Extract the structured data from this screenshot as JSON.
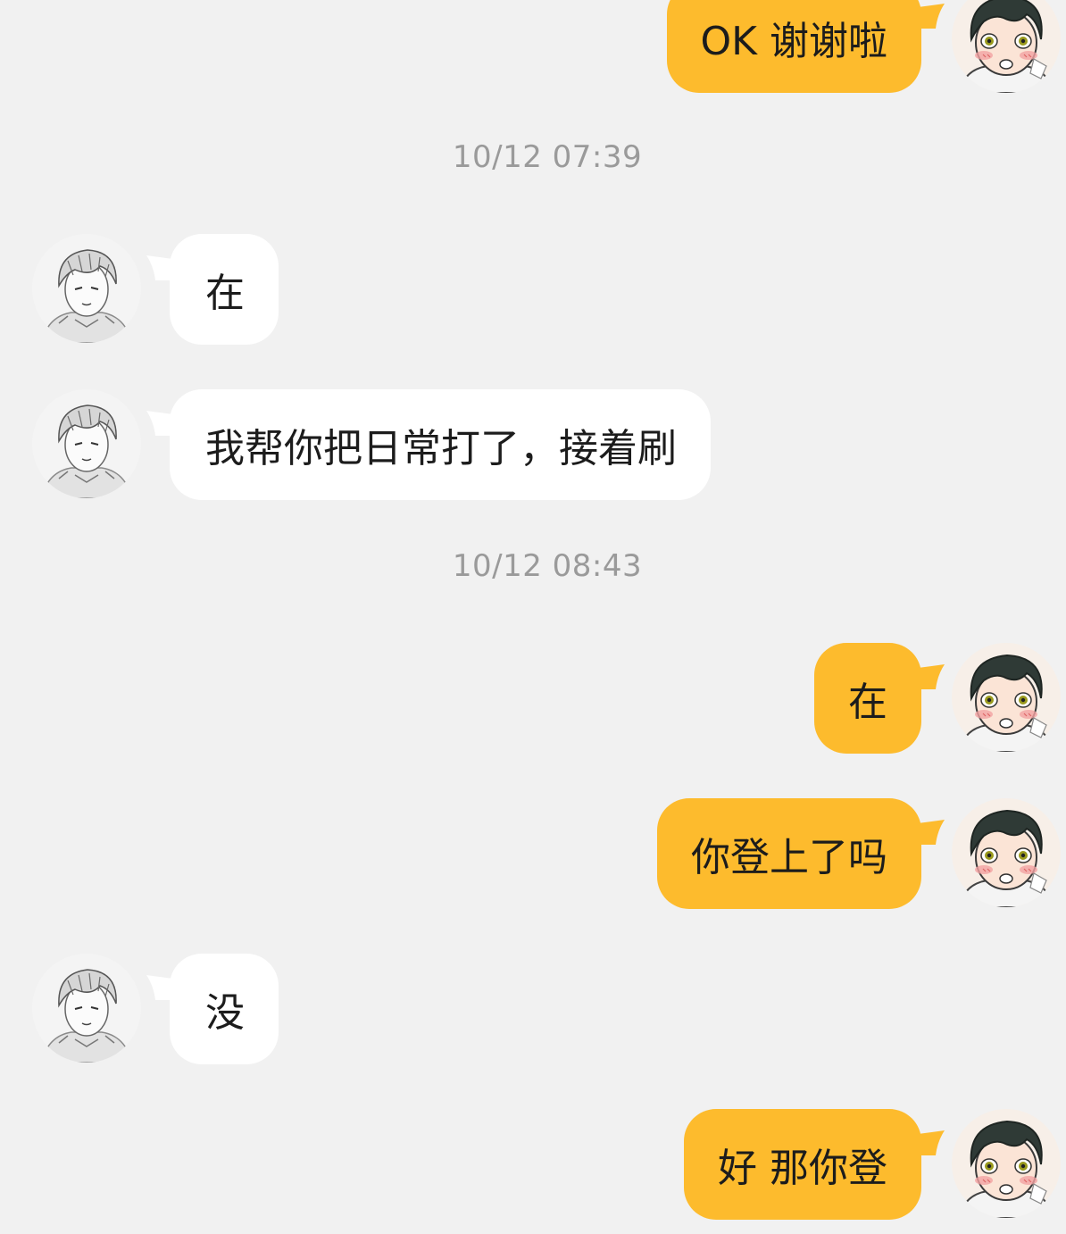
{
  "conversation": {
    "messages": [
      {
        "side": "outgoing",
        "text": "OK 谢谢啦"
      },
      {
        "timestamp": "10/12 07:39"
      },
      {
        "side": "incoming",
        "text": "在"
      },
      {
        "side": "incoming",
        "text": "我帮你把日常打了，接着刷"
      },
      {
        "timestamp": "10/12 08:43"
      },
      {
        "side": "outgoing",
        "text": "在"
      },
      {
        "side": "outgoing",
        "text": "你登上了吗"
      },
      {
        "side": "incoming",
        "text": "没"
      },
      {
        "side": "outgoing",
        "text": "好 那你登"
      }
    ]
  },
  "colors": {
    "background": "#f1f1f1",
    "incoming_bubble": "#ffffff",
    "outgoing_bubble": "#fdbb2d",
    "timestamp_text": "#9a9a9a"
  },
  "icons": {
    "incoming_avatar": "manga-boy-avatar-icon",
    "outgoing_avatar": "anime-blushing-boy-avatar-icon"
  }
}
